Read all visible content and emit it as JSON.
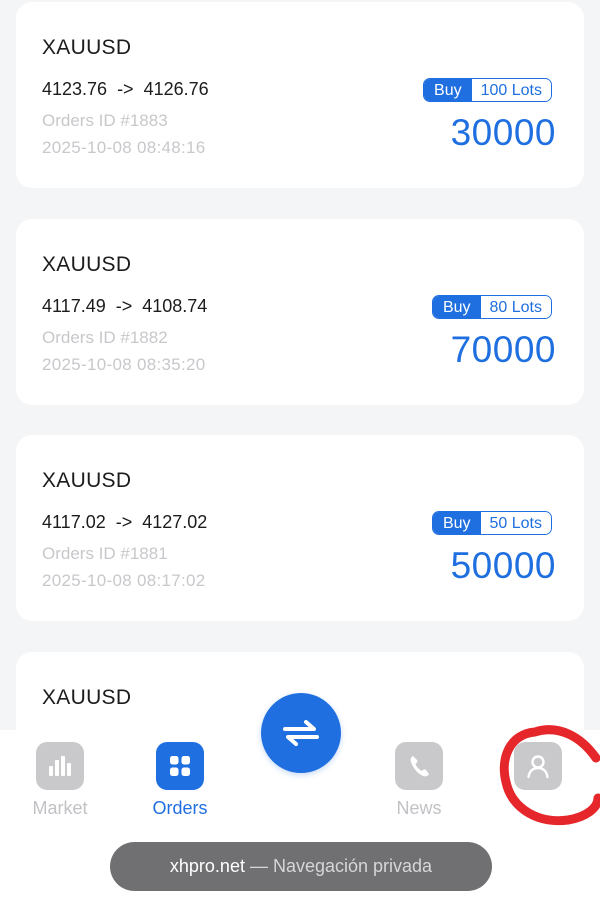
{
  "orders": [
    {
      "symbol": "XAUUSD",
      "prices": "4123.76  ->  4126.76",
      "order_id": "Orders ID #1883",
      "time": "2025-10-08 08:48:16",
      "side": "Buy",
      "lots": "100 Lots",
      "amount": "30000"
    },
    {
      "symbol": "XAUUSD",
      "prices": "4117.49  ->  4108.74",
      "order_id": "Orders ID #1882",
      "time": "2025-10-08 08:35:20",
      "side": "Buy",
      "lots": "80 Lots",
      "amount": "70000"
    },
    {
      "symbol": "XAUUSD",
      "prices": "4117.02  ->  4127.02",
      "order_id": "Orders ID #1881",
      "time": "2025-10-08 08:17:02",
      "side": "Buy",
      "lots": "50 Lots",
      "amount": "50000"
    },
    {
      "symbol": "XAUUSD"
    }
  ],
  "tabbar": {
    "market": {
      "label": "Market",
      "icon": "bar-chart-icon"
    },
    "orders": {
      "label": "Orders",
      "icon": "grid-icon"
    },
    "trade": {
      "icon": "swap-arrows-icon"
    },
    "news": {
      "label": "News",
      "icon": "phone-icon"
    },
    "profile": {
      "label": "",
      "icon": "user-icon"
    }
  },
  "browser_bar": {
    "domain": "xhpro.net",
    "mode": " — Navegación privada"
  },
  "colors": {
    "accent": "#1f6fe0",
    "inactive": "#c2c2c6",
    "annotation": "#e5262b"
  }
}
